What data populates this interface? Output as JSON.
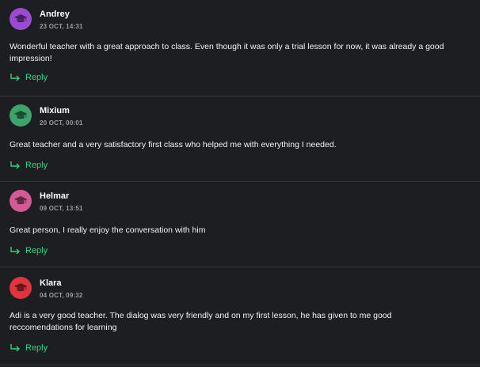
{
  "reply_label": "Reply",
  "colors": {
    "background": "#1d1e22",
    "accent": "#35d07f",
    "divider": "#34363c"
  },
  "comments": [
    {
      "author": "Andrey",
      "date": "23 OCT, 14:31",
      "avatar_color": "#9a4bd1",
      "avatar_icon": "graduation-cap-icon",
      "text": "Wonderful teacher with a great approach to class. Even though it was only a trial lesson for now, it was already a good impression!"
    },
    {
      "author": "Mixium",
      "date": "20 OCT, 00:01",
      "avatar_color": "#3ea36a",
      "avatar_icon": "graduation-cap-icon",
      "text": "Great teacher and a very satisfactory first class who helped me with everything I needed."
    },
    {
      "author": "Helmar",
      "date": "09 OCT, 13:51",
      "avatar_color": "#d45a96",
      "avatar_icon": "graduation-cap-icon",
      "text": "Great person, I really enjoy the conversation with him"
    },
    {
      "author": "Klara",
      "date": "04 OCT, 09:32",
      "avatar_color": "#e0343f",
      "avatar_icon": "graduation-cap-icon",
      "text": "Adi is a very good teacher. The dialog was very friendly and on my first lesson, he has given to me good reccomendations for learning"
    }
  ]
}
